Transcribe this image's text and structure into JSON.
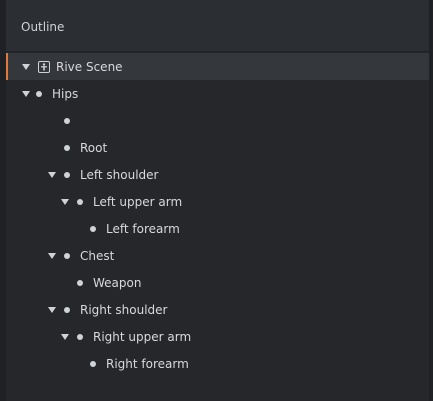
{
  "panel": {
    "title": "Outline"
  },
  "tree": [
    {
      "label": "Rive Scene",
      "depth": 0,
      "expanded": true,
      "kind": "scene",
      "selected": true
    },
    {
      "label": "Hips",
      "depth": 1,
      "expanded": true,
      "kind": "node"
    },
    {
      "label": "",
      "depth": 3,
      "expanded": null,
      "kind": "node"
    },
    {
      "label": "Root",
      "depth": 3,
      "expanded": null,
      "kind": "node"
    },
    {
      "label": "Left shoulder",
      "depth": 2,
      "expanded": true,
      "kind": "node"
    },
    {
      "label": "Left upper arm",
      "depth": 3,
      "expanded": true,
      "kind": "node"
    },
    {
      "label": "Left forearm",
      "depth": 4,
      "expanded": null,
      "kind": "node"
    },
    {
      "label": "Chest",
      "depth": 2,
      "expanded": true,
      "kind": "node"
    },
    {
      "label": "Weapon",
      "depth": 3,
      "expanded": null,
      "kind": "node"
    },
    {
      "label": "Right shoulder",
      "depth": 2,
      "expanded": true,
      "kind": "node"
    },
    {
      "label": "Right upper arm",
      "depth": 3,
      "expanded": true,
      "kind": "node"
    },
    {
      "label": "Right forearm",
      "depth": 4,
      "expanded": null,
      "kind": "node"
    }
  ],
  "colors": {
    "selection_accent": "#e07a3a",
    "background": "#25272b",
    "text": "#d7d9dd"
  },
  "icons": {
    "scene": "person-scene-icon",
    "node": "bullet-icon",
    "expand": "caret-down-icon"
  }
}
